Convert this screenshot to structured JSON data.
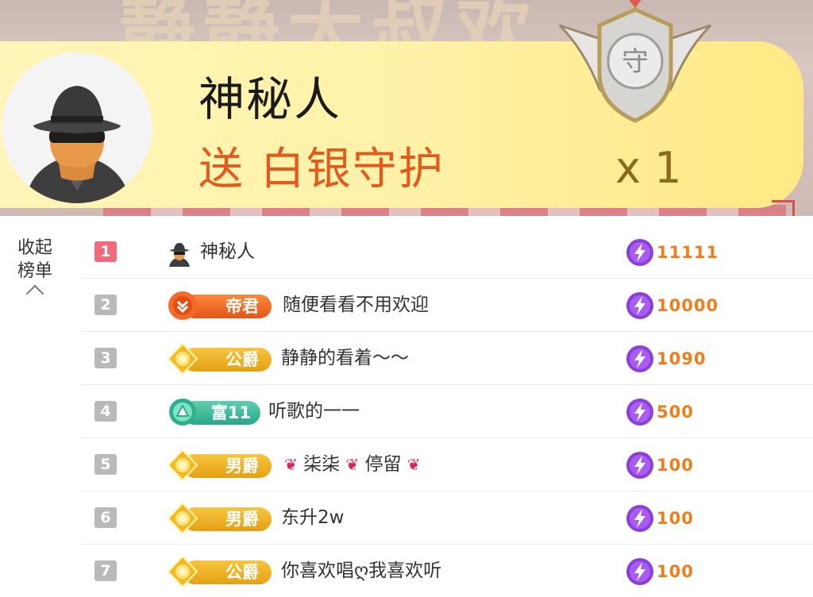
{
  "banner": {
    "background_text": "静静大叔欢",
    "sender_name": "神秘人",
    "gift_line": "送 白银守护",
    "gift_count": "x 1",
    "badge_char": "守"
  },
  "collapse": {
    "line1": "收起",
    "line2": "榜单"
  },
  "leaderboard": [
    {
      "rank": "1",
      "badge": null,
      "name": "神秘人",
      "score": "11111",
      "avatar_icon": "mystery-man-icon"
    },
    {
      "rank": "2",
      "badge": {
        "label": "帝君",
        "style": "orange"
      },
      "name": "随便看看不用欢迎",
      "score": "10000"
    },
    {
      "rank": "3",
      "badge": {
        "label": "公爵",
        "style": "gold"
      },
      "name": "静静的看着～～",
      "score": "1090"
    },
    {
      "rank": "4",
      "badge": {
        "label": "富11",
        "style": "teal"
      },
      "name": "听歌的一一",
      "score": "500"
    },
    {
      "rank": "5",
      "badge": {
        "label": "男爵",
        "style": "gold"
      },
      "name_parts": [
        "柒柒",
        "停留"
      ],
      "score": "100"
    },
    {
      "rank": "6",
      "badge": {
        "label": "男爵",
        "style": "gold"
      },
      "name": "东升2w",
      "score": "100"
    },
    {
      "rank": "7",
      "badge": {
        "label": "公爵",
        "style": "gold"
      },
      "name": "你喜欢唱ღ我喜欢听",
      "score": "100"
    }
  ],
  "colors": {
    "score": "#f07d1a",
    "rank_first": "#f36a7a",
    "rank_other": "#b9b9b9",
    "gift_text": "#e25a1c"
  }
}
